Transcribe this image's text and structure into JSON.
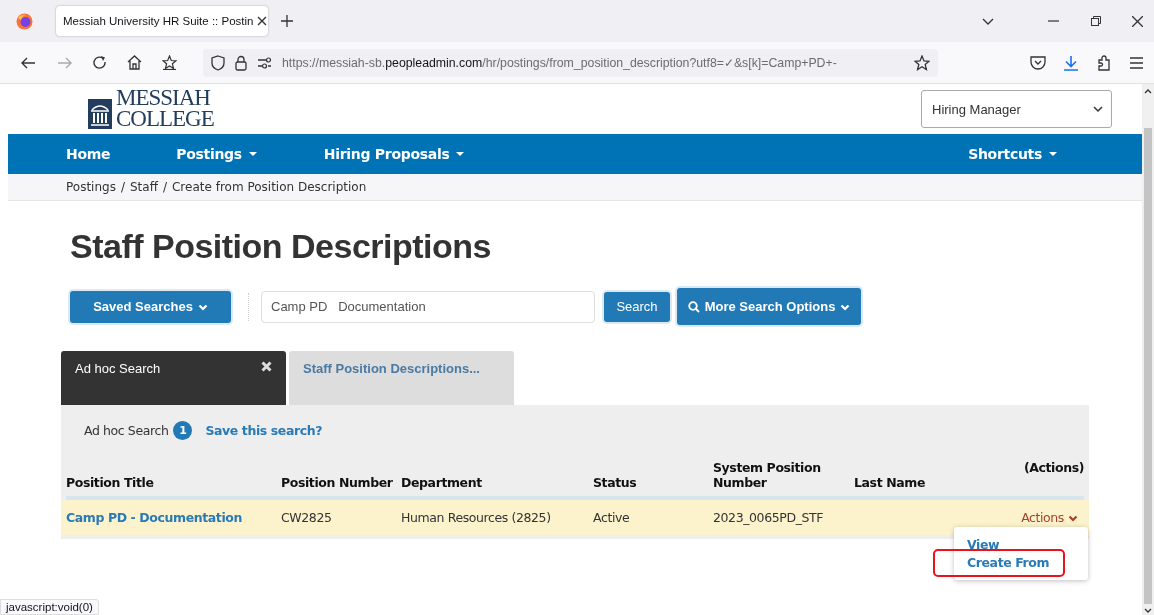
{
  "browser": {
    "tab": {
      "title": "Messiah University HR Suite :: Postin",
      "selected": true
    },
    "address": {
      "host": "https://messiah-sb.",
      "domain": "peopleadmin.com",
      "path": "/hr/postings/from_position_description?utf8=✓&s[k]=Camp+PD+-"
    },
    "status_text": "javascript:void(0)"
  },
  "header": {
    "logo": [
      "MESSIAH",
      "COLLEGE"
    ],
    "role_select": {
      "value": "Hiring Manager"
    }
  },
  "nav": [
    {
      "label": "Home",
      "dropdown": false
    },
    {
      "label": "Postings",
      "dropdown": true
    },
    {
      "label": "Hiring Proposals",
      "dropdown": true
    },
    {
      "label": "Shortcuts",
      "dropdown": true
    }
  ],
  "breadcrumb": {
    "separator": "/",
    "items": [
      "Postings",
      "Staff",
      "Create from Position Description"
    ]
  },
  "page_title": "Staff Position Descriptions",
  "search": {
    "saved_searches": "Saved Searches",
    "query": "Camp PD   Documentation",
    "search_button": "Search",
    "more_options": "More Search Options"
  },
  "search_tabs": [
    {
      "label": "Ad hoc Search",
      "selected": true,
      "closable": true
    },
    {
      "label": "Staff Position Descriptions...",
      "selected": false,
      "closable": false
    }
  ],
  "results": {
    "label": "Ad hoc Search",
    "count": "1",
    "save_link": "Save this search?",
    "columns": [
      "Position Title",
      "Position Number",
      "Department",
      "Status",
      "System Position Number",
      "Last Name",
      "(Actions)"
    ],
    "rows": [
      {
        "cells": [
          "Camp PD - Documentation",
          "CW2825",
          "Human Resources (2825)",
          "Active",
          "2023_0065PD_STF"
        ],
        "actions": "Actions",
        "highlighted": true
      }
    ],
    "actions_menu": [
      {
        "label": "View",
        "highlighted": false
      },
      {
        "label": "Create From",
        "highlighted": true
      }
    ]
  }
}
